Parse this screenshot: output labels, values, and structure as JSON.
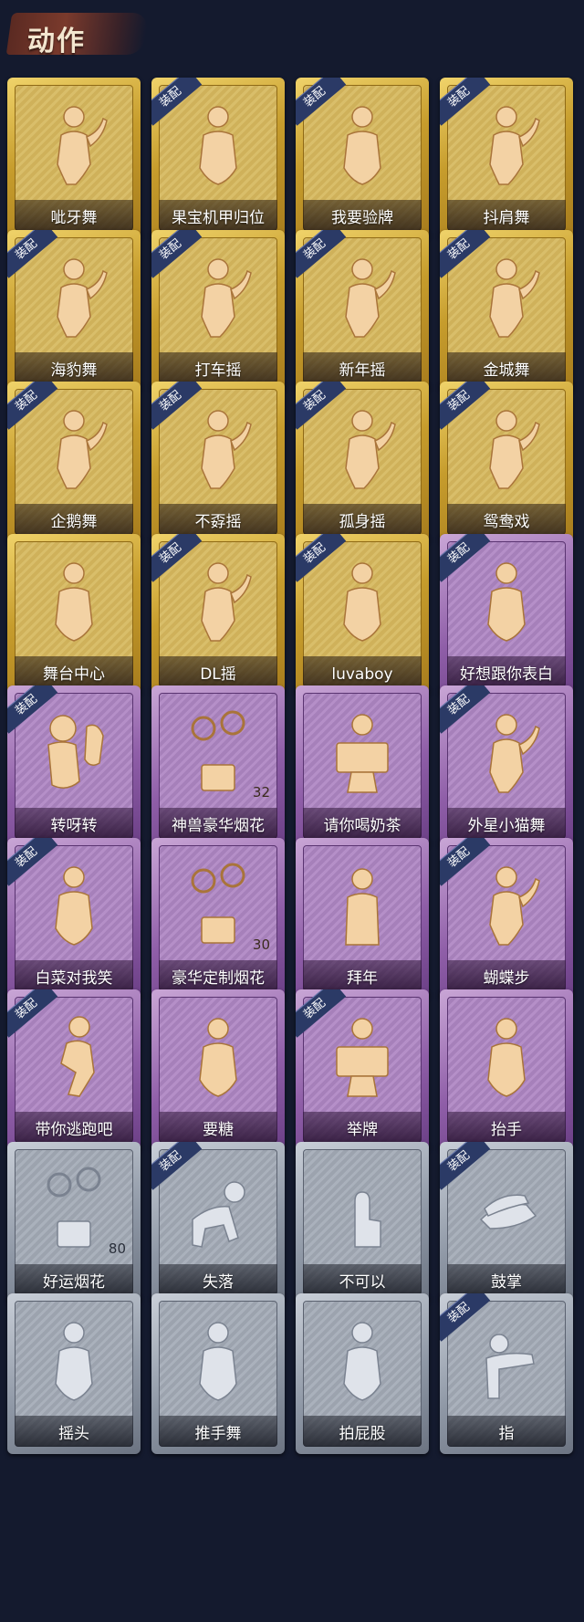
{
  "header": {
    "title": "动作"
  },
  "equip_tag": "装配",
  "colors": {
    "gold": "#c69c2c",
    "purple": "#8f5ea8",
    "gray": "#8f98a6",
    "tag": "#2b3a66"
  },
  "actions": [
    {
      "label": "呲牙舞",
      "rarity": "gold",
      "equipped": false,
      "icon": "dance-figure-icon"
    },
    {
      "label": "果宝机甲归位",
      "rarity": "gold",
      "equipped": true,
      "icon": "pose-figure-icon"
    },
    {
      "label": "我要验牌",
      "rarity": "gold",
      "equipped": true,
      "icon": "pose-figure-icon"
    },
    {
      "label": "抖肩舞",
      "rarity": "gold",
      "equipped": true,
      "icon": "dance-figure-icon"
    },
    {
      "label": "海豹舞",
      "rarity": "gold",
      "equipped": true,
      "icon": "dance-figure-icon"
    },
    {
      "label": "打车摇",
      "rarity": "gold",
      "equipped": true,
      "icon": "dance-figure-icon"
    },
    {
      "label": "新年摇",
      "rarity": "gold",
      "equipped": true,
      "icon": "dance-figure-icon"
    },
    {
      "label": "金城舞",
      "rarity": "gold",
      "equipped": true,
      "icon": "dance-figure-icon"
    },
    {
      "label": "企鹅舞",
      "rarity": "gold",
      "equipped": true,
      "icon": "dance-figure-icon"
    },
    {
      "label": "不孬摇",
      "rarity": "gold",
      "equipped": true,
      "icon": "dance-figure-icon"
    },
    {
      "label": "孤身摇",
      "rarity": "gold",
      "equipped": true,
      "icon": "dance-figure-icon"
    },
    {
      "label": "鸳鸯戏",
      "rarity": "gold",
      "equipped": true,
      "icon": "dance-figure-icon"
    },
    {
      "label": "舞台中心",
      "rarity": "gold",
      "equipped": false,
      "icon": "pose-figure-icon"
    },
    {
      "label": "DL摇",
      "rarity": "gold",
      "equipped": true,
      "icon": "dance-figure-icon"
    },
    {
      "label": "luvaboy",
      "rarity": "gold",
      "equipped": true,
      "icon": "pose-figure-icon"
    },
    {
      "label": "好想跟你表白",
      "rarity": "purple",
      "equipped": true,
      "icon": "pose-figure-icon"
    },
    {
      "label": "转呀转",
      "rarity": "purple",
      "equipped": true,
      "icon": "puppet-figure-icon"
    },
    {
      "label": "神兽豪华烟花",
      "rarity": "purple",
      "equipped": false,
      "icon": "fireworks-icon",
      "count": "32"
    },
    {
      "label": "请你喝奶茶",
      "rarity": "purple",
      "equipped": false,
      "icon": "sign-figure-icon"
    },
    {
      "label": "外星小猫舞",
      "rarity": "purple",
      "equipped": true,
      "icon": "dance-figure-icon"
    },
    {
      "label": "白菜对我笑",
      "rarity": "purple",
      "equipped": true,
      "icon": "pose-figure-icon"
    },
    {
      "label": "豪华定制烟花",
      "rarity": "purple",
      "equipped": false,
      "icon": "fireworks-icon",
      "count": "30"
    },
    {
      "label": "拜年",
      "rarity": "purple",
      "equipped": false,
      "icon": "bow-figure-icon"
    },
    {
      "label": "蝴蝶步",
      "rarity": "purple",
      "equipped": true,
      "icon": "dance-figure-icon"
    },
    {
      "label": "带你逃跑吧",
      "rarity": "purple",
      "equipped": true,
      "icon": "run-figure-icon"
    },
    {
      "label": "要糖",
      "rarity": "purple",
      "equipped": false,
      "icon": "pose-figure-icon"
    },
    {
      "label": "举牌",
      "rarity": "purple",
      "equipped": true,
      "icon": "sign-figure-icon"
    },
    {
      "label": "抬手",
      "rarity": "purple",
      "equipped": false,
      "icon": "pose-figure-icon"
    },
    {
      "label": "好运烟花",
      "rarity": "gray",
      "equipped": false,
      "icon": "fireworks-icon",
      "count": "80"
    },
    {
      "label": "失落",
      "rarity": "gray",
      "equipped": true,
      "icon": "crawl-figure-icon"
    },
    {
      "label": "不可以",
      "rarity": "gray",
      "equipped": false,
      "icon": "finger-icon"
    },
    {
      "label": "鼓掌",
      "rarity": "gray",
      "equipped": true,
      "icon": "clap-icon"
    },
    {
      "label": "摇头",
      "rarity": "gray",
      "equipped": false,
      "icon": "pose-figure-icon"
    },
    {
      "label": "推手舞",
      "rarity": "gray",
      "equipped": false,
      "icon": "pose-figure-icon"
    },
    {
      "label": "拍屁股",
      "rarity": "gray",
      "equipped": false,
      "icon": "pose-figure-icon"
    },
    {
      "label": "指",
      "rarity": "gray",
      "equipped": true,
      "icon": "point-icon"
    }
  ]
}
